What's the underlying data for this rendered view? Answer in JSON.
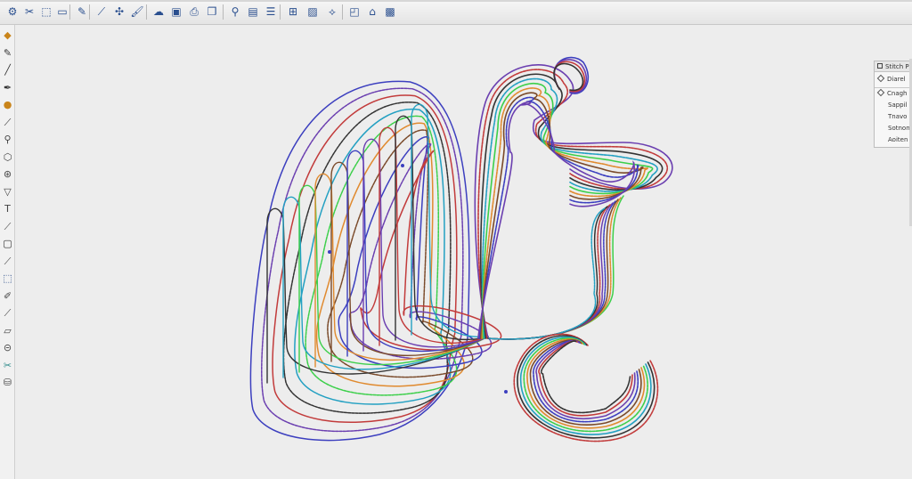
{
  "toolbar": {
    "buttons": [
      "settings-icon",
      "scissors-icon",
      "select-frame-icon",
      "screen-icon",
      "pen-tool-icon",
      "pipette-icon",
      "transform-icon",
      "brush-icon",
      "cloud-icon",
      "frame-icon",
      "print-icon",
      "pages-icon",
      "zoom-icon",
      "save-icon",
      "list-icon",
      "grid-icon",
      "image-icon",
      "navigate-icon",
      "select-rect-icon",
      "lock-icon",
      "palette-icon"
    ]
  },
  "left_tools": [
    "palette-tool-icon",
    "pencil-tool-icon",
    "line-tool-icon",
    "pen-tool-icon",
    "fill-tool-icon",
    "brush-tool-icon",
    "magnify-tool-icon",
    "shape-tool-icon",
    "node-tool-icon",
    "text-tool-icon",
    "text-size-tool-icon",
    "needle-tool-icon",
    "frame-tool-icon",
    "eyedropper-tool-icon",
    "select-tool-icon",
    "eraser-tool-icon",
    "marker-tool-icon",
    "parallelogram-tool-icon",
    "spool-tool-icon",
    "cut-tool-icon",
    "bucket-tool-icon"
  ],
  "panel": {
    "title": "Stitch P",
    "rows": [
      "Diarel",
      "Cnagh",
      "Sappil",
      "Tnavo",
      "Sotnon",
      "Aoiten"
    ]
  },
  "colors": {
    "canvas": "#ededed",
    "thread_purple": "#6b3fb0",
    "thread_blue": "#3c3fbf",
    "thread_red": "#c23b3b",
    "thread_green": "#3ccf4a",
    "thread_teal": "#23a0c2",
    "thread_black": "#333333",
    "thread_orange": "#e08a2f",
    "thread_brown": "#7a4a2a"
  }
}
